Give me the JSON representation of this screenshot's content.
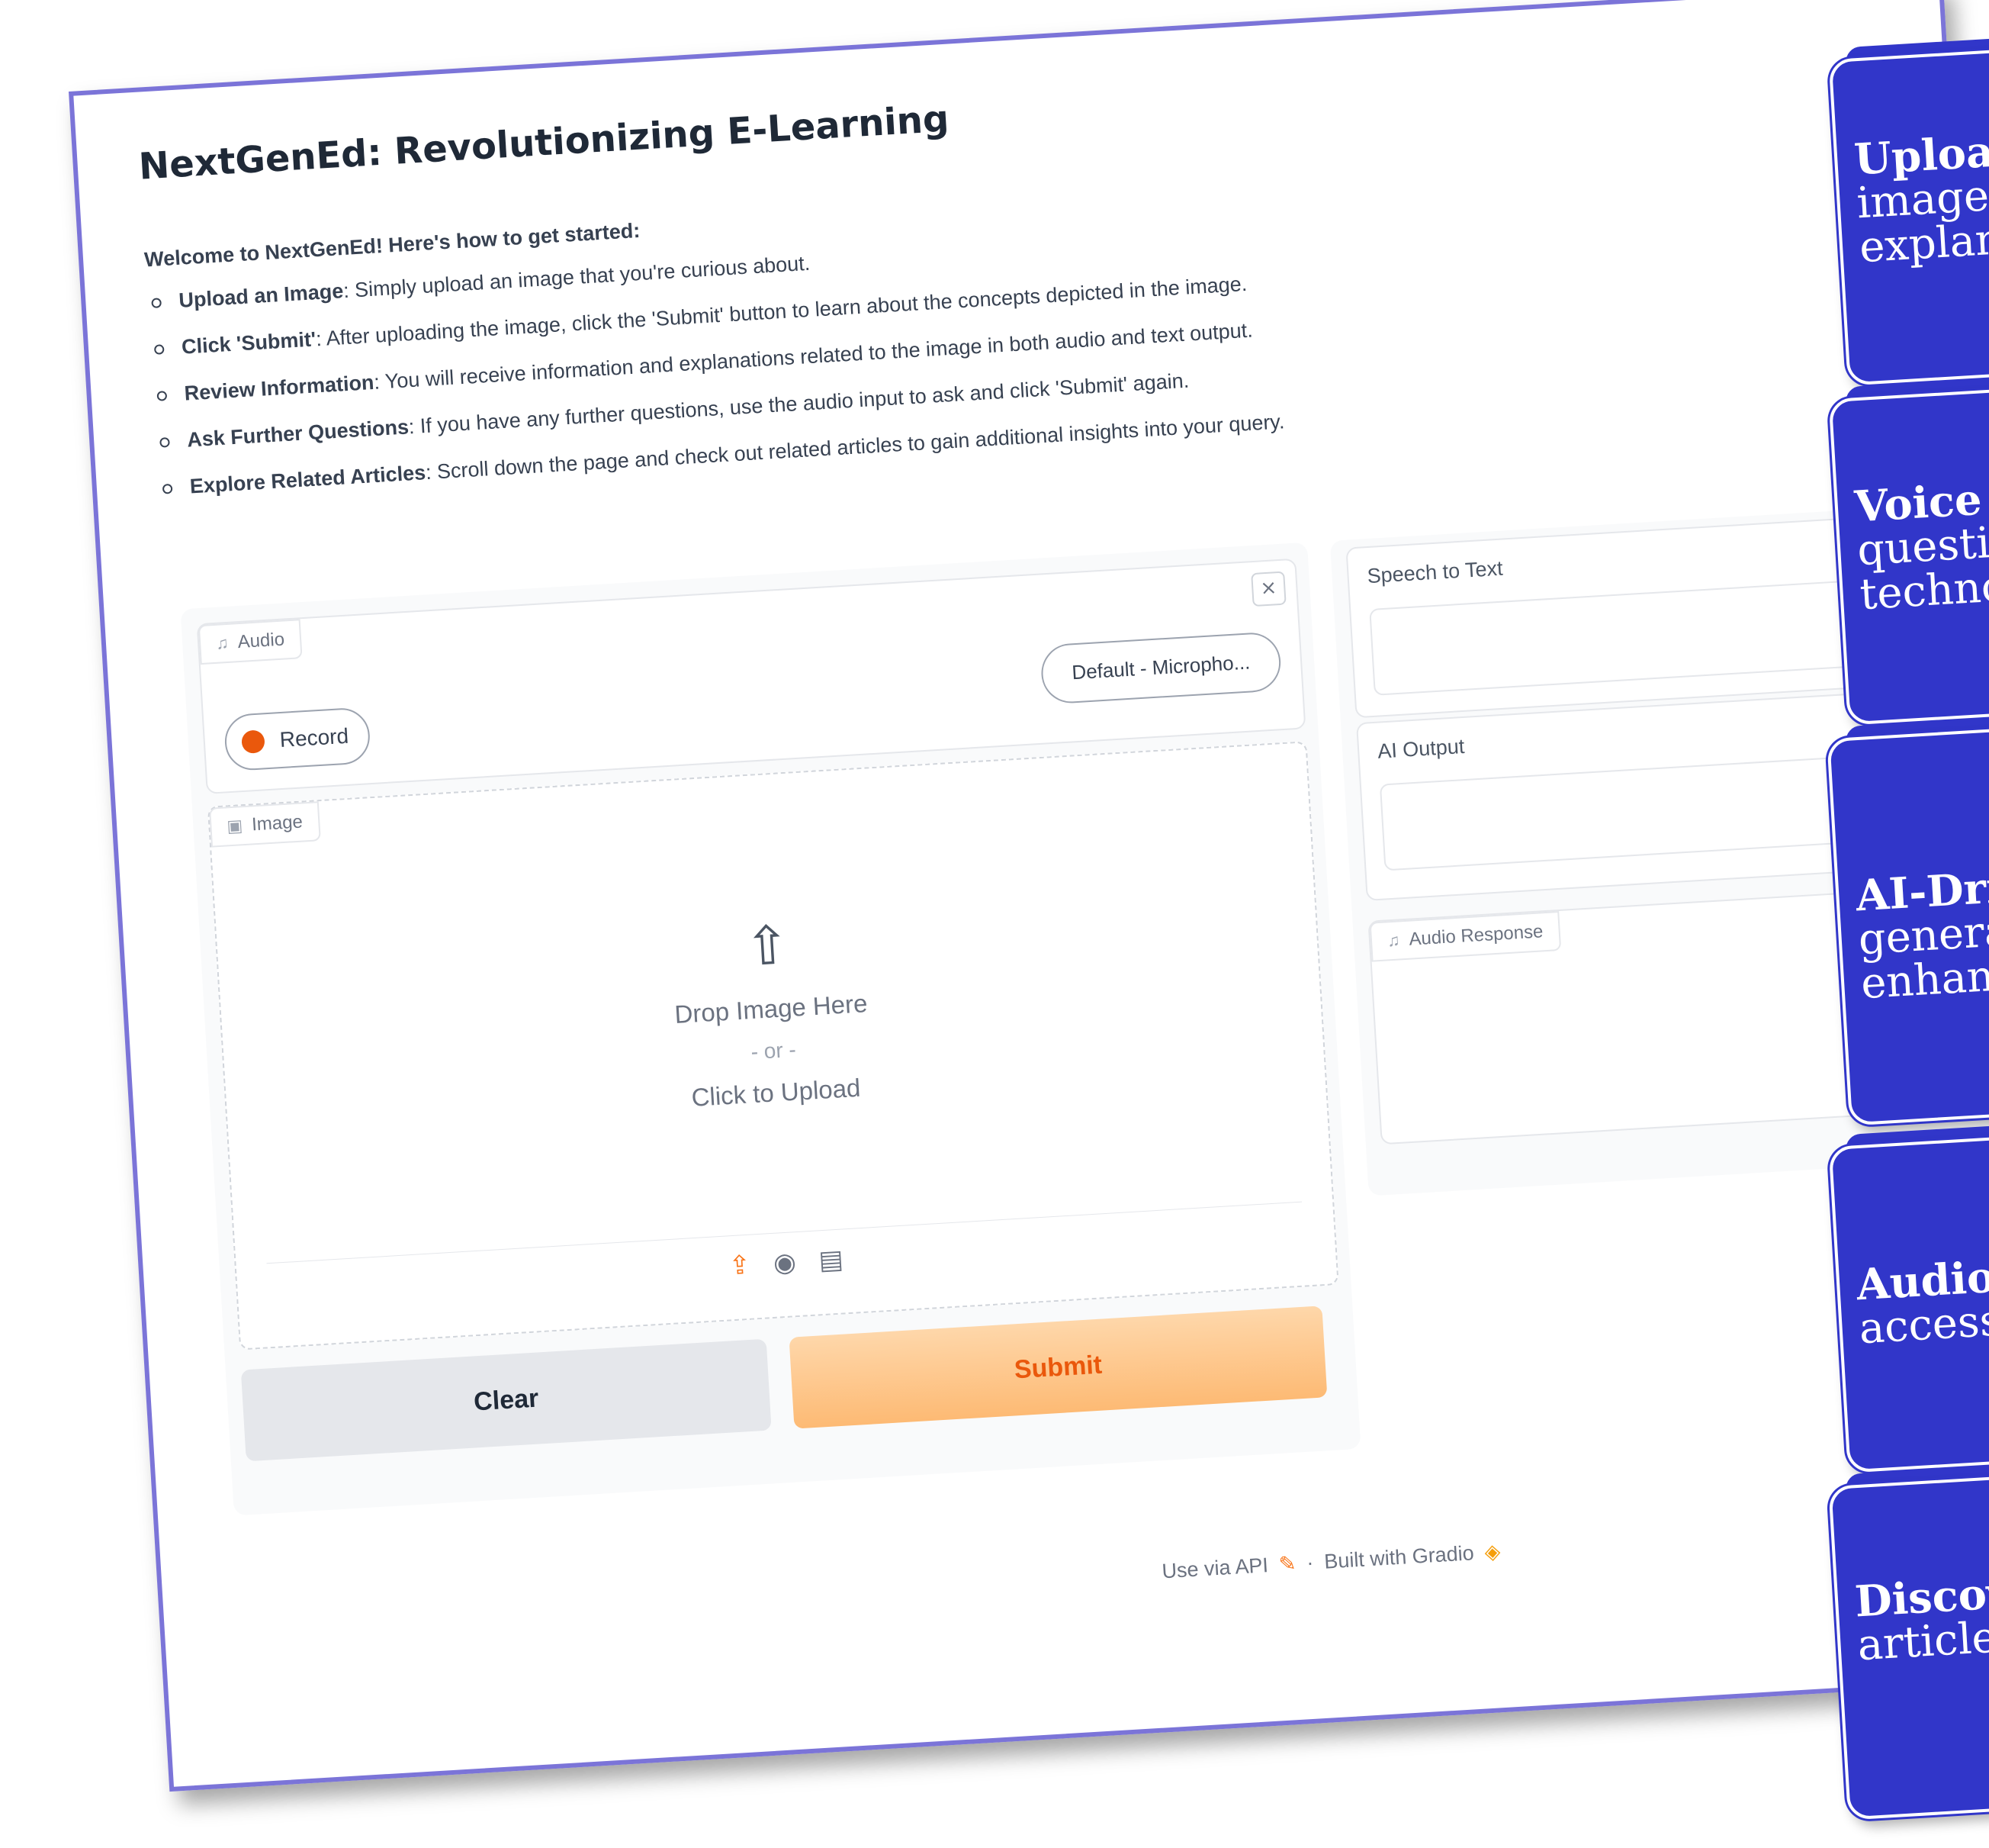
{
  "app": {
    "title": "NextGenEd: Revolutionizing E-Learning"
  },
  "intro": {
    "welcome": "Welcome to NextGenEd! Here's how to get started:",
    "steps": [
      {
        "label": "Upload an Image",
        "text": ": Simply upload an image that you're curious about."
      },
      {
        "label": "Click 'Submit'",
        "text": ": After uploading the image, click the 'Submit' button to learn about the concepts depicted in the image."
      },
      {
        "label": "Review Information",
        "text": ": You will receive information and explanations related to the image in both audio and text output."
      },
      {
        "label": "Ask Further Questions",
        "text": ": If you have any further questions, use the audio input to ask and click 'Submit' again."
      },
      {
        "label": "Explore Related Articles",
        "text": ": Scroll down the page and check out related articles to gain additional insights into your query."
      }
    ]
  },
  "audio_input": {
    "label": "Audio",
    "label_icon": "music-note-icon",
    "record_label": "Record",
    "microphone_value": "Default - Micropho...",
    "close_glyph": "×"
  },
  "image_input": {
    "label": "Image",
    "label_icon": "image-icon",
    "drop_text": "Drop Image Here",
    "or_text": "- or -",
    "click_text": "Click to Upload",
    "source_icons": [
      "upload-icon",
      "webcam-icon",
      "clipboard-icon"
    ]
  },
  "buttons": {
    "clear": "Clear",
    "submit": "Submit"
  },
  "outputs": {
    "speech_label": "Speech to Text",
    "speech_value": "",
    "ai_label": "AI Output",
    "ai_value": "",
    "audio_response_label": "Audio Response"
  },
  "footer": {
    "api": "Use via API",
    "separator": "·",
    "built": "Built with Gradio"
  },
  "cards": [
    {
      "title": "Upload",
      "lines": [
        "image,",
        "explana"
      ]
    },
    {
      "title": "Voice in",
      "lines": [
        "question",
        "technolo"
      ]
    },
    {
      "title": "AI-Driv",
      "lines": [
        "generate",
        "enhanci"
      ]
    },
    {
      "title": "Audio I",
      "lines": [
        "accessib"
      ]
    },
    {
      "title": "Discove",
      "lines": [
        "articles."
      ]
    }
  ],
  "colors": {
    "frame_border": "#7b74d8",
    "card_background": "#3136c9",
    "accent": "#f97316",
    "record_dot": "#ea580c"
  }
}
